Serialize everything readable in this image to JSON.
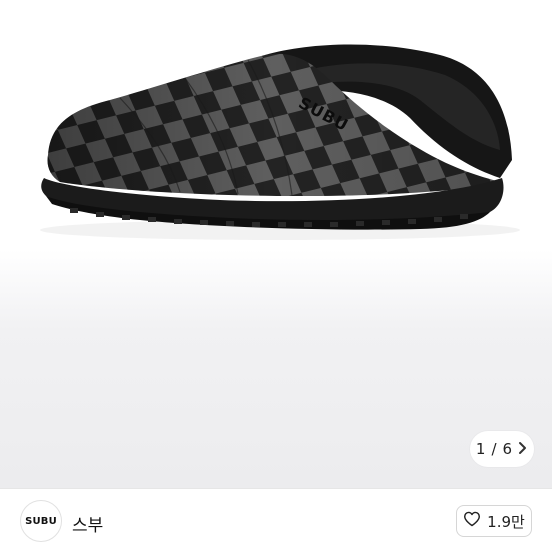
{
  "gallery": {
    "current": "1",
    "separator": "/",
    "total": "6",
    "next_icon": "chevron-right-icon"
  },
  "product": {
    "logo_text": "SUBU",
    "sole_color": "#1b1b1b",
    "check_colors": [
      "#222222",
      "#5e5e5e"
    ]
  },
  "brand": {
    "logo_text": "SUBU",
    "name": "스부"
  },
  "like": {
    "icon": "heart-outline-icon",
    "count": "1.9만"
  }
}
